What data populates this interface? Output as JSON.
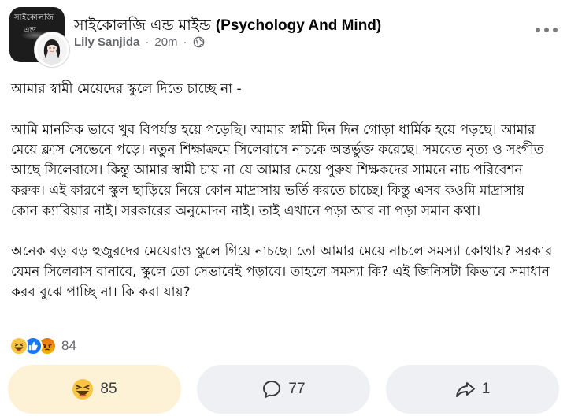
{
  "post": {
    "group_name_bn": "সাইকোলজি এন্ড মাইন্ড ",
    "group_name_en": "(Psychology And Mind)",
    "group_avatar_text_1": "সাইকোলজি",
    "group_avatar_text_2": "এন্ড",
    "author": "Lily Sanjida",
    "time": "20m",
    "separator": "·",
    "privacy_icon": "globe-icon",
    "more_icon": "more-options-icon"
  },
  "body": {
    "paragraphs": [
      "আমার স্বামী মেয়েদের স্কুলে দিতে চাচ্ছে না -",
      "আমি মানসিক ভাবে খুব বিপর্যস্ত হয়ে পড়েছি। আমার স্বামী দিন দিন গোড়া ধার্মিক হয়ে পড়ছে। আমার মেয়ে ক্লাস সেভেনে পড়ে। নতুন শিক্ষাক্রমে সিলেবাসে নাচকে অন্তর্ভুক্ত করেছে। সমবেত নৃত্য ও সংগীত আছে সিলেবাসে। কিন্তু আমার স্বামী চায় না যে আমার মেয়ে পুরুষ শিক্ষকদের সামনে নাচ পরিবেশন করুক। এই কারণে স্কুল ছাড়িয়ে নিয়ে কোন মাদ্রাসায় ভর্তি করতে চাচ্ছে। কিন্তু এসব কওমি মাদ্রাসায় কোন ক্যারিয়ার নাই। সরকারের অনুমোদন নাই। তাই এখানে পড়া আর না পড়া সমান কথা।",
      "অনেক বড় বড় হুজুরদের মেয়েরাও স্কুলে গিয়ে নাচছে। তো আমার মেয়ে নাচলে সমস্যা কোথায়? সরকার যেমন সিলেবাস বানাবে, স্কুলে তো সেভাবেই পড়াবে। তাহলে সমস্যা কি? এই জিনিসটা কিভাবে সমাধান করব বুঝে পাচ্ছি না। কি করা যায়?"
    ]
  },
  "reactions": {
    "types": [
      "haha",
      "like",
      "angry"
    ],
    "total": "84"
  },
  "actions": {
    "react_count": "85",
    "comment_count": "77",
    "share_count": "1",
    "react_icon": "haha-emoji-icon",
    "comment_icon": "comment-bubble-icon",
    "share_icon": "share-arrow-icon"
  },
  "colors": {
    "haha": "#f7c543",
    "like": "#1877f2",
    "angry_top": "#e9710f",
    "meta_gray": "#65676b",
    "button_bg": "#eef0f3",
    "reacted_bg": "#fdf2d6"
  }
}
